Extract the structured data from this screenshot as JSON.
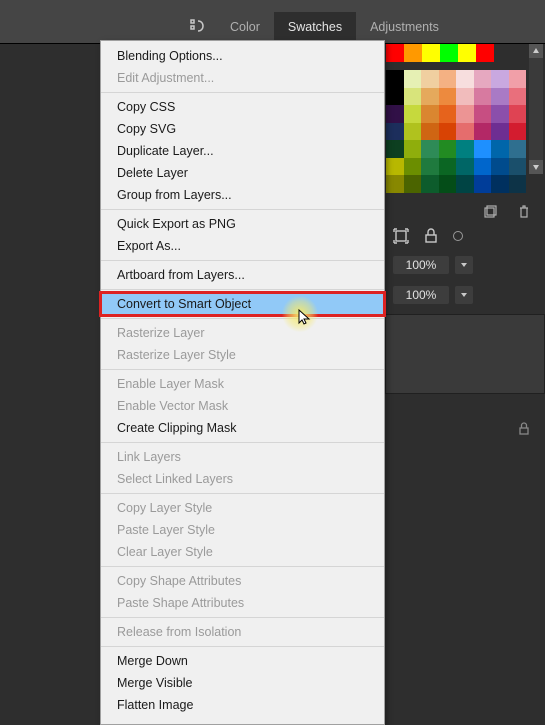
{
  "tabs": {
    "color": "Color",
    "swatches": "Swatches",
    "adjustments": "Adjustments"
  },
  "menu": {
    "blending_options": "Blending Options...",
    "edit_adjustment": "Edit Adjustment...",
    "copy_css": "Copy CSS",
    "copy_svg": "Copy SVG",
    "duplicate_layer": "Duplicate Layer...",
    "delete_layer": "Delete Layer",
    "group_from_layers": "Group from Layers...",
    "quick_export_png": "Quick Export as PNG",
    "export_as": "Export As...",
    "artboard_from_layers": "Artboard from Layers...",
    "convert_smart": "Convert to Smart Object",
    "rasterize_layer": "Rasterize Layer",
    "rasterize_style": "Rasterize Layer Style",
    "enable_layer_mask": "Enable Layer Mask",
    "enable_vector_mask": "Enable Vector Mask",
    "create_clipping_mask": "Create Clipping Mask",
    "link_layers": "Link Layers",
    "select_linked": "Select Linked Layers",
    "copy_layer_style": "Copy Layer Style",
    "paste_layer_style": "Paste Layer Style",
    "clear_layer_style": "Clear Layer Style",
    "copy_shape_attr": "Copy Shape Attributes",
    "paste_shape_attr": "Paste Shape Attributes",
    "release_isolation": "Release from Isolation",
    "merge_down": "Merge Down",
    "merge_visible": "Merge Visible",
    "flatten_image": "Flatten Image"
  },
  "panel": {
    "opacity_value": "100%",
    "fill_value": "100%"
  },
  "swatches_bigrow": [
    "#ff0000",
    "#ff9900",
    "#ffff00",
    "#00ff00",
    "#ffff00",
    "#ff0000"
  ],
  "swatches_grid": [
    "#000000",
    "#e6f0b4",
    "#f0cfa0",
    "#f4b183",
    "#f7dede",
    "#e6a8c0",
    "#c9a8e0",
    "#f19fa8",
    "#000000",
    "#d8e47b",
    "#e5a95c",
    "#ed8a3e",
    "#f1bcbc",
    "#d77aa0",
    "#a97ac5",
    "#e96f7c",
    "#311047",
    "#c6d93d",
    "#da8630",
    "#e6631c",
    "#ec9494",
    "#c74e82",
    "#8b4fab",
    "#df4353",
    "#1c2e5c",
    "#b0c21e",
    "#cf6513",
    "#d84304",
    "#e56d6d",
    "#b32866",
    "#6e2e92",
    "#d31c2f",
    "#0d3f20",
    "#8fae0c",
    "#2e8b57",
    "#228b22",
    "#008080",
    "#1e90ff",
    "#0066aa",
    "#2f6f8f",
    "#b8b800",
    "#6b8e00",
    "#1f7a3e",
    "#0b6623",
    "#006666",
    "#0066cc",
    "#004b8d",
    "#1a4f6b",
    "#888800",
    "#4b6400",
    "#0d5c2c",
    "#044d18",
    "#004444",
    "#003d99",
    "#00305f",
    "#0d3347"
  ]
}
